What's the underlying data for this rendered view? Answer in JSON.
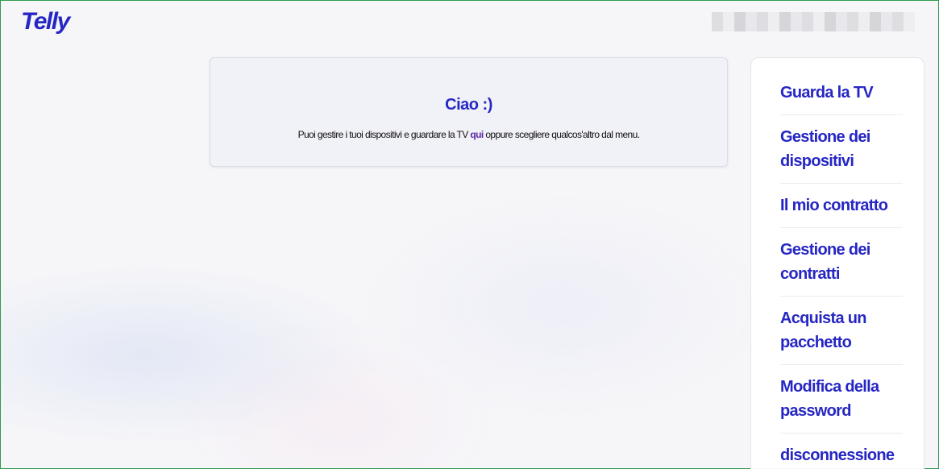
{
  "header": {
    "logo_text": "Telly"
  },
  "welcome": {
    "title": "Ciao :)",
    "text_before": "Puoi gestire i tuoi dispositivi e guardare la TV ",
    "link_text": "qui",
    "text_after": " oppure scegliere qualcos'altro dal menu."
  },
  "sidebar": {
    "items": [
      {
        "label": "Guarda la TV"
      },
      {
        "label": "Gestione dei dispositivi"
      },
      {
        "label": "Il mio contratto"
      },
      {
        "label": "Gestione dei contratti"
      },
      {
        "label": "Acquista un pacchetto"
      },
      {
        "label": "Modifica della password"
      },
      {
        "label": "disconnessione"
      }
    ]
  },
  "colors": {
    "brand": "#2626c4",
    "link": "#5a2aa5",
    "border_accent": "#2e9b4e"
  }
}
